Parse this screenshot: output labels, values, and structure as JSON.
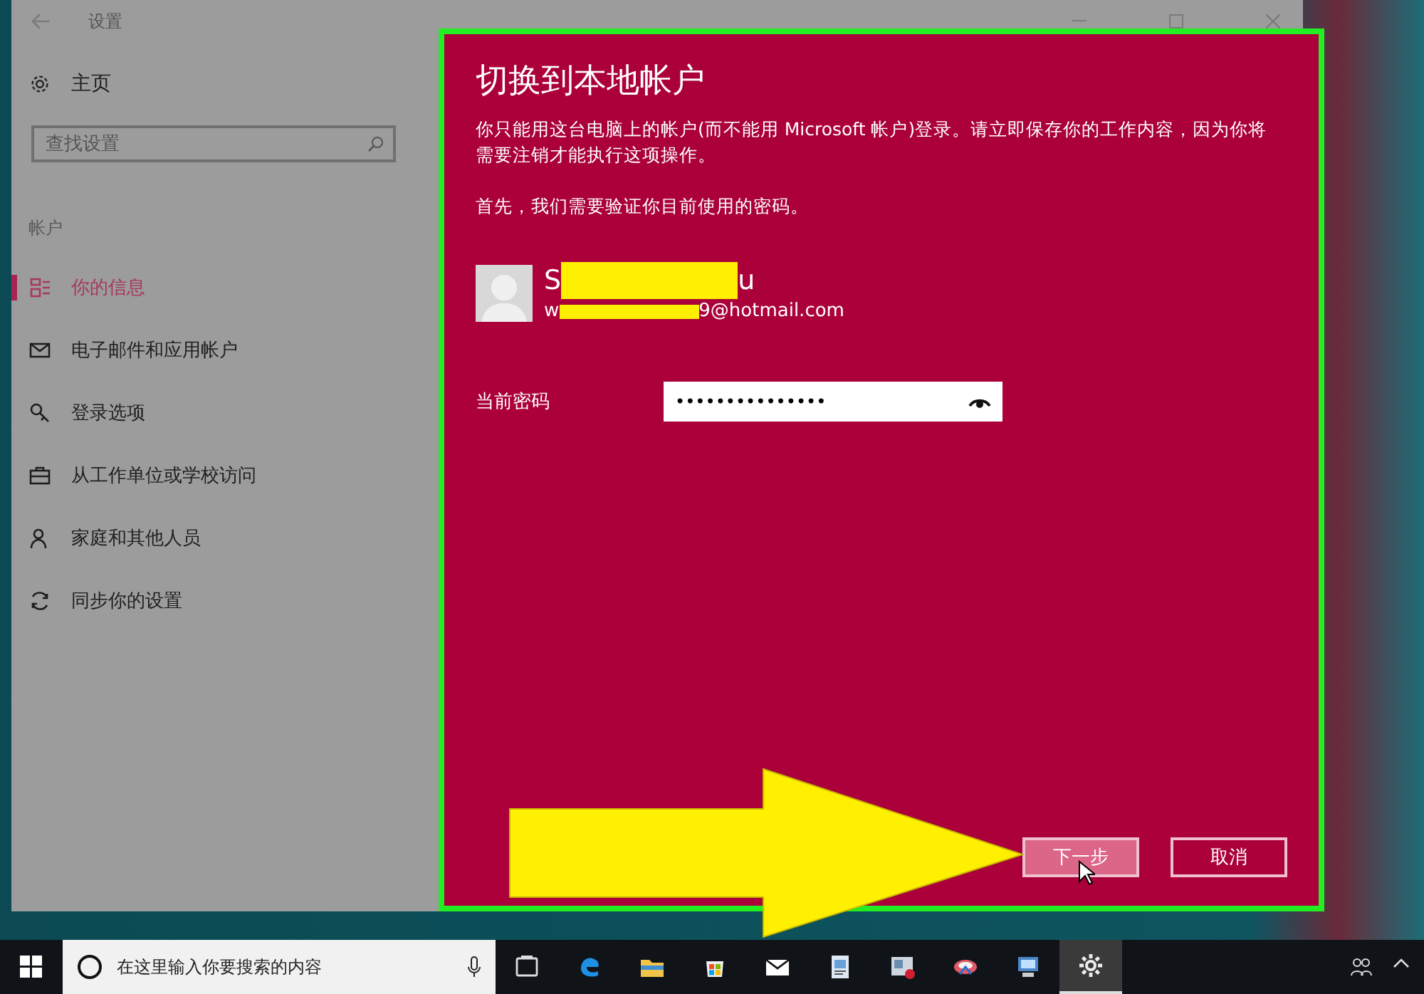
{
  "window": {
    "title": "设置"
  },
  "sidebar": {
    "home": "主页",
    "search": {
      "placeholder": "查找设置"
    },
    "section": "帐户",
    "items": [
      {
        "label": "你的信息",
        "selected": true
      },
      {
        "label": "电子邮件和应用帐户",
        "selected": false
      },
      {
        "label": "登录选项",
        "selected": false
      },
      {
        "label": "从工作单位或学校访问",
        "selected": false
      },
      {
        "label": "家庭和其他人员",
        "selected": false
      },
      {
        "label": "同步你的设置",
        "selected": false
      }
    ]
  },
  "dialog": {
    "title": "切换到本地帐户",
    "paragraphs": [
      "你只能用这台电脑上的帐户(而不能用 Microsoft 帐户)登录。请立即保存你的工作内容，因为你将需要注销才能执行这项操作。",
      "首先，我们需要验证你目前使用的密码。"
    ],
    "account": {
      "name_start": "S",
      "name_end": "u",
      "email_start": "w",
      "email_end": "9@hotmail.com"
    },
    "password": {
      "label": "当前密码",
      "value": "•••••••••••••••"
    },
    "buttons": [
      {
        "label": "下一步",
        "kind": "primary"
      },
      {
        "label": "取消",
        "kind": "secondary"
      }
    ]
  },
  "taskbar": {
    "search": {
      "placeholder": "在这里输入你要搜索的内容"
    }
  }
}
